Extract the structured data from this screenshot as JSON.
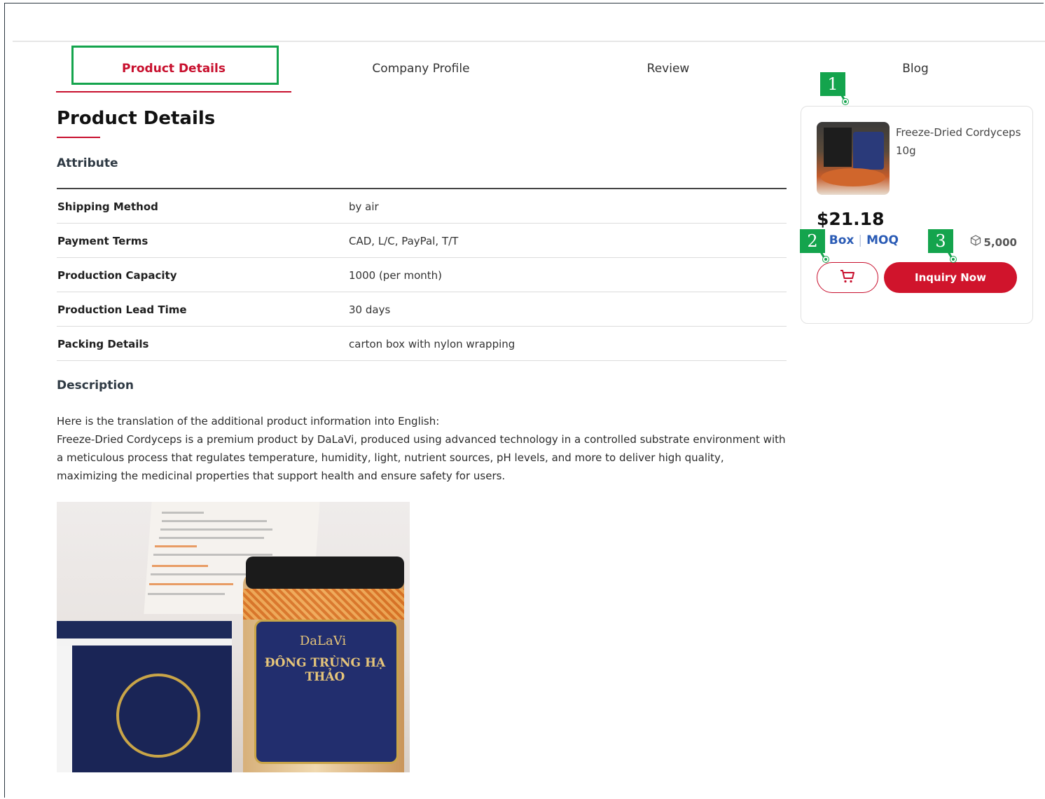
{
  "tabs": {
    "product_details": "Product Details",
    "company_profile": "Company Profile",
    "review": "Review",
    "blog": "Blog"
  },
  "main": {
    "title": "Product Details",
    "attribute_label": "Attribute",
    "description_label": "Description",
    "attributes": [
      {
        "key": "Shipping Method",
        "value": "by air"
      },
      {
        "key": "Payment Terms",
        "value": "CAD, L/C, PayPal, T/T"
      },
      {
        "key": "Production Capacity",
        "value": "1000 (per month)"
      },
      {
        "key": "Production Lead Time",
        "value": "30 days"
      },
      {
        "key": "Packing Details",
        "value": "carton box with nylon wrapping"
      }
    ],
    "description": [
      "Here is the translation of the additional product information into English:",
      "Freeze-Dried Cordyceps is a premium product by DaLaVi, produced using advanced technology in a controlled substrate environment with a meticulous process that regulates temperature, humidity, light, nutrient sources, pH levels, and more to deliver high quality, maximizing the medicinal properties that support health and ensure safety for users."
    ],
    "photo": {
      "brand": "DaLaVi",
      "label_title": "ĐÔNG TRÙNG HẠ THẢO"
    }
  },
  "card": {
    "product_name": "Freeze-Dried Cordyceps 10g",
    "price": "$21.18",
    "moq_qty": "0 Box",
    "moq_label": "MOQ",
    "stock": "5,000",
    "inquiry_label": "Inquiry Now"
  },
  "markers": [
    "1",
    "2",
    "3"
  ],
  "colors": {
    "accent_red": "#c8102e",
    "moq_blue": "#2a5bb5",
    "annotation_green": "#14a44d"
  },
  "icons": {
    "cart": "cart-icon",
    "stock": "cube-icon"
  }
}
